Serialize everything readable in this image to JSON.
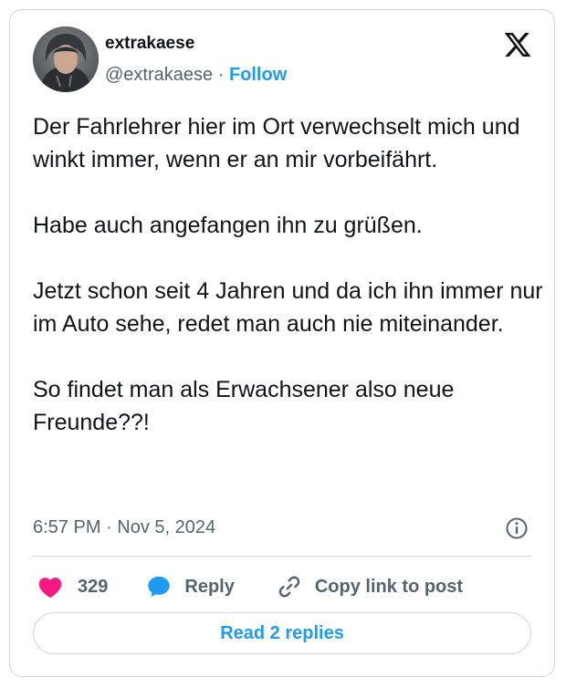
{
  "author": {
    "display_name": "extrakaese",
    "handle": "@extrakaese",
    "separator": "·",
    "follow_label": "Follow"
  },
  "tweet": {
    "paragraphs": [
      "Der Fahrlehrer hier im Ort verwechselt mich und winkt immer, wenn er an mir vorbeifährt.",
      "Habe auch angefangen ihn zu grüßen.",
      "Jetzt schon seit 4 Jahren und da ich ihn immer nur im Auto sehe, redet man auch nie miteinander.",
      "So findet man als Erwachsener also neue Freunde??!"
    ],
    "timestamp": "6:57 PM · Nov 5, 2024"
  },
  "actions": {
    "like_count": "329",
    "reply_label": "Reply",
    "copy_link_label": "Copy link to post"
  },
  "read_replies_label": "Read 2 replies",
  "icons": {
    "logo": "x-logo-icon",
    "info": "info-icon",
    "like": "heart-icon",
    "reply": "speech-bubble-icon",
    "copy": "link-icon"
  },
  "colors": {
    "accent": "#1d9bf0",
    "like": "#f91880",
    "muted_text": "#536471",
    "border": "#cfd9de"
  }
}
